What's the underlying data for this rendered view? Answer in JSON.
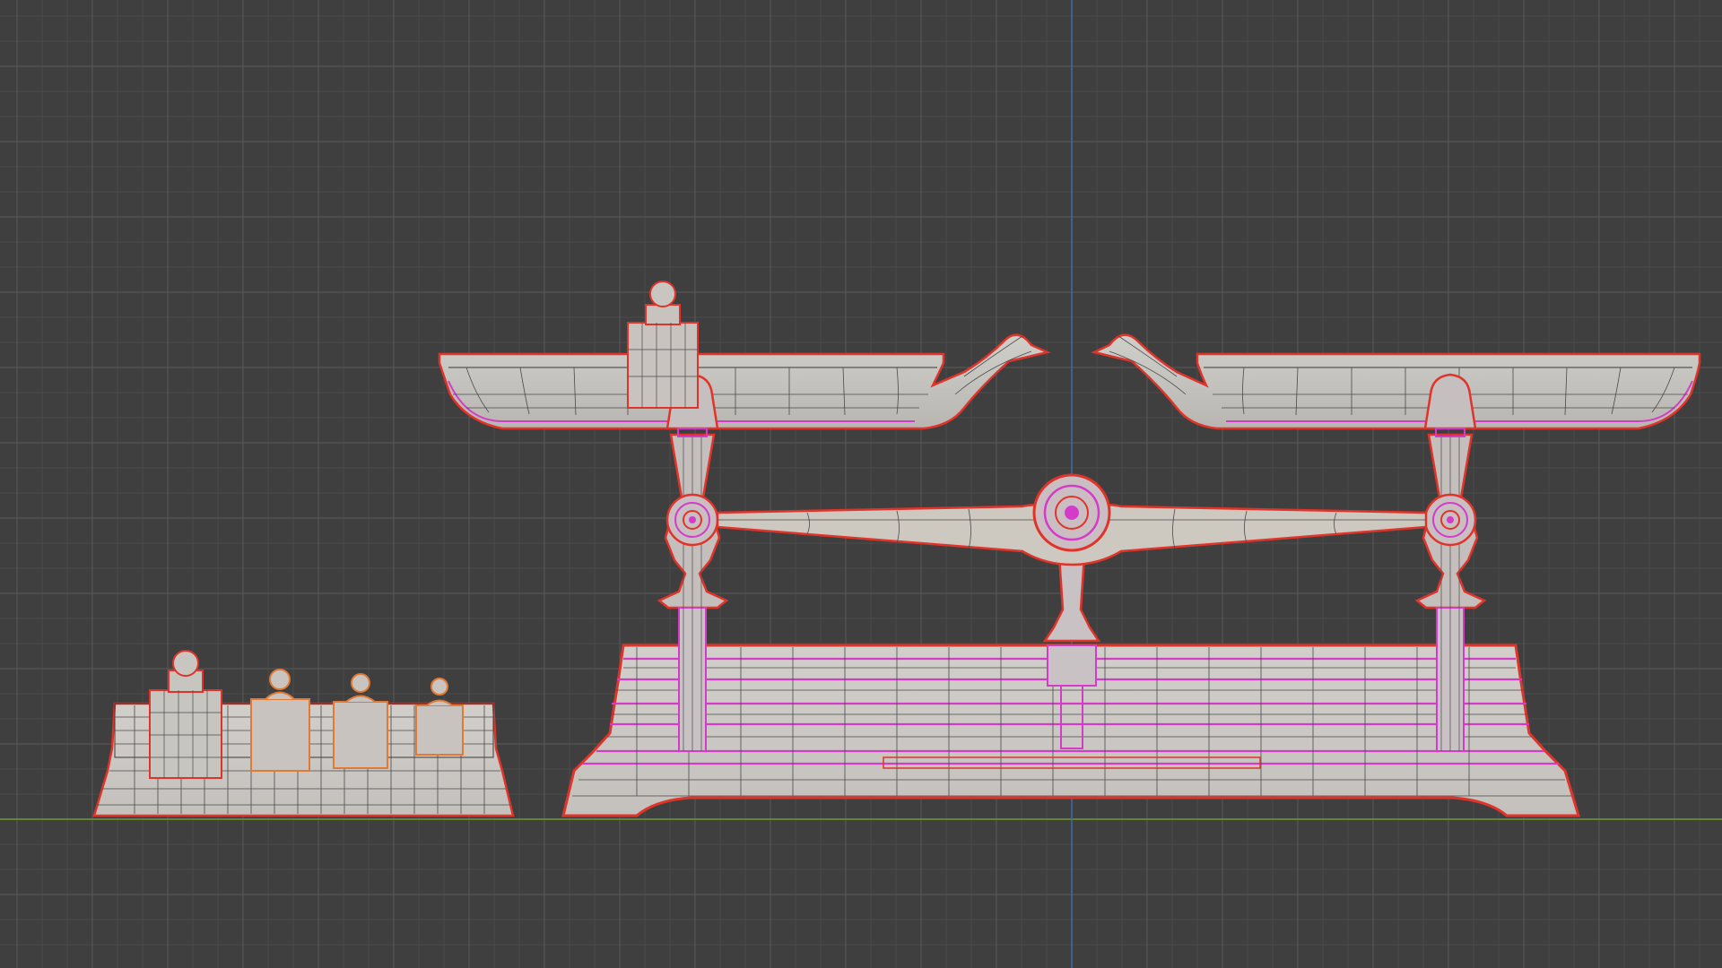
{
  "viewport": {
    "view": "front-orthographic",
    "shading": "wireframe-over-solid",
    "grid": true,
    "colors": {
      "background": "#3f3f3f",
      "grid_minor": "#4b4b4b",
      "grid_major": "#565656",
      "x_axis": "#6f9a2e",
      "z_axis": "#3f6aa5",
      "mesh_fill": "#c9c9c4",
      "mesh_fill_selected": "#cfc4c8",
      "wire": "#3a3a3a",
      "active_outline": "#e0342a",
      "selected_outline": "#d43bc8",
      "weight_outline": "#e07a35"
    }
  },
  "objects": [
    {
      "name": "balance-scale",
      "selected": true
    },
    {
      "name": "weight-box",
      "selected": true
    },
    {
      "name": "weights",
      "count": 5
    }
  ]
}
